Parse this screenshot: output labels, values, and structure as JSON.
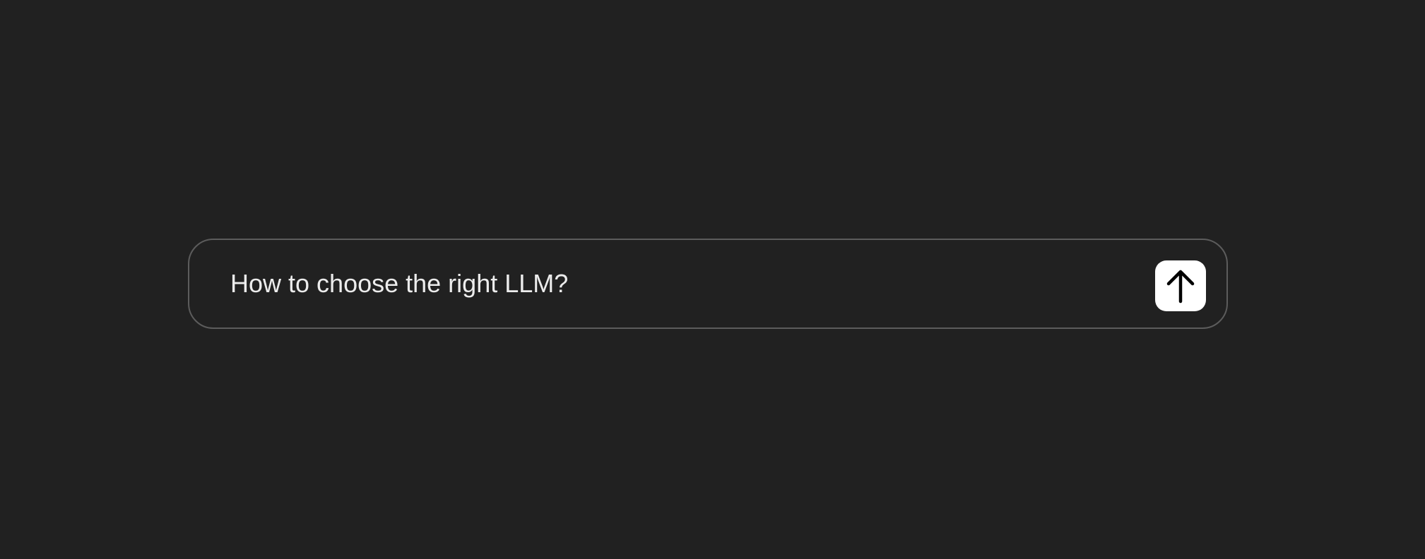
{
  "prompt": {
    "text": "How to choose the right LLM?"
  },
  "send_button": {
    "icon": "arrow-up-icon"
  },
  "colors": {
    "background": "#212121",
    "border": "#5c5c5c",
    "text": "#ececec",
    "send_button_bg": "#ffffff",
    "send_icon": "#000000"
  }
}
